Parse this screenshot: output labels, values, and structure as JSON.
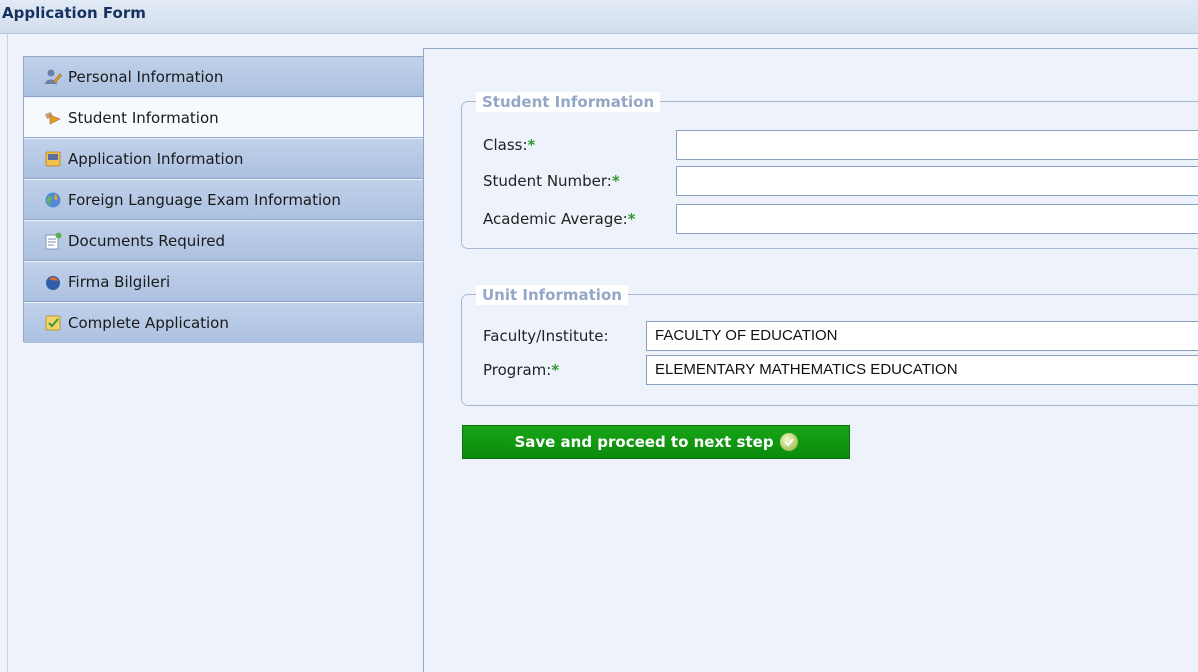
{
  "window": {
    "title": "Application Form"
  },
  "sidebar": {
    "items": [
      {
        "label": "Personal Information",
        "icon": "person-edit-icon"
      },
      {
        "label": "Student Information",
        "icon": "student-arrow-icon"
      },
      {
        "label": "Application Information",
        "icon": "notebook-icon"
      },
      {
        "label": "Foreign Language Exam Information",
        "icon": "globe-icon"
      },
      {
        "label": "Documents Required",
        "icon": "document-add-icon"
      },
      {
        "label": "Firma Bilgileri",
        "icon": "company-icon"
      },
      {
        "label": "Complete Application",
        "icon": "checklist-icon"
      }
    ],
    "active_index": 1
  },
  "student_section": {
    "legend": "Student Information",
    "class_label": "Class:",
    "student_number_label": "Student Number:",
    "academic_average_label": "Academic Average:",
    "required_mark": "*",
    "class_value": "",
    "student_number_value": "",
    "academic_average_value": ""
  },
  "unit_section": {
    "legend": "Unit Information",
    "faculty_label": "Faculty/Institute:",
    "program_label": "Program:",
    "required_mark": "*",
    "faculty_value": "FACULTY OF EDUCATION",
    "program_value": "ELEMENTARY MATHEMATICS EDUCATION"
  },
  "actions": {
    "save_label": "Save and proceed to next step"
  },
  "colors": {
    "accent_green": "#0f960f",
    "sidebar_blue": "#b6c8e6",
    "legend_gray": "#93a7c6",
    "required_green": "#2f9a2f"
  }
}
